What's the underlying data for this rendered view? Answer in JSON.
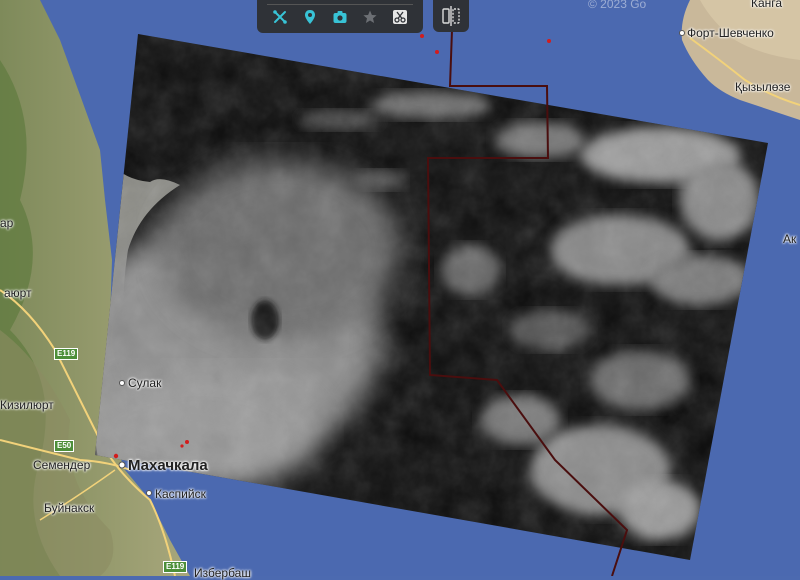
{
  "map": {
    "copyright": "© 2023 Go",
    "place_labels": {
      "kanga": "Канга",
      "fort_shevchenko": "Форт-Шевченко",
      "kyzylozen": "Қызылөзе",
      "ak": "Ак",
      "ar": "ар",
      "aurt": "аюрт",
      "sulak": "Сулак",
      "kizilyurt": "Кизилюрт",
      "semender": "Семендер",
      "makhachkala": "Махачкала",
      "kaspiysk": "Каспийск",
      "buynaksk": "Буйнакск",
      "bottom_partial": "Избербаш"
    },
    "road_badges": {
      "e119_north": "E119",
      "e50": "E50",
      "e119_south": "E119"
    }
  },
  "toolbar": {
    "tools": [
      "measure-tool",
      "place-marker",
      "screenshot",
      "favorite",
      "scissors"
    ]
  }
}
